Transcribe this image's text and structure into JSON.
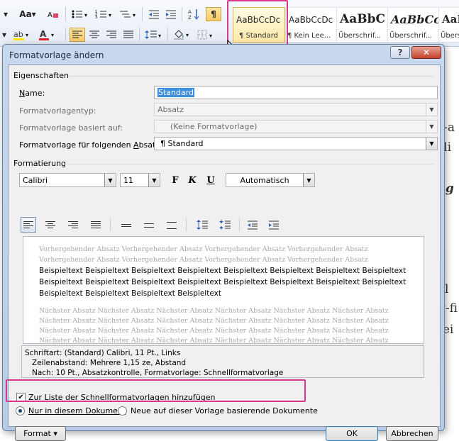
{
  "ribbon": {
    "font_size_btn": "Aa",
    "pilcrow": "¶",
    "styles": [
      {
        "sample": "AaBbCcDc",
        "caption": "¶ Standard"
      },
      {
        "sample": "AaBbCcDc",
        "caption": "¶ Kein Lee..."
      },
      {
        "sample": "AaBbC",
        "caption": "Überschrif..."
      },
      {
        "sample": "AaBbCc",
        "caption": "Überschrif..."
      },
      {
        "sample": "AaB",
        "caption": "Übers"
      }
    ]
  },
  "doc_fragments": [
    "r-a",
    "rli",
    "eg",
    "el",
    "g-fi",
    "tei"
  ],
  "dialog": {
    "title": "Formatvorlage ändern",
    "help_label": "?",
    "close_label": "✕",
    "section_properties": "Eigenschaften",
    "name_label": "Name:",
    "name_value": "Standard",
    "type_label": "Formatvorlagentyp:",
    "type_value": "Absatz",
    "based_label": "Formatvorlage basiert auf:",
    "based_value": "(Keine Formatvorlage)",
    "next_label": "Formatvorlage für folgenden Absatz:",
    "next_value": "¶  Standard",
    "section_formatting": "Formatierung",
    "font_value": "Calibri",
    "size_value": "11",
    "bold_label": "F",
    "italic_label": "K",
    "underline_label": "U",
    "color_value": "Automatisch",
    "preview": {
      "previous": "Vorhergehender Absatz Vorhergehender Absatz Vorhergehender Absatz Vorhergehender Absatz Vorhergehender Absatz Vorhergehender Absatz Vorhergehender Absatz Vorhergehender Absatz",
      "sample": "Beispieltext Beispieltext Beispieltext Beispieltext Beispieltext Beispieltext Beispieltext Beispieltext Beispieltext Beispieltext Beispieltext Beispieltext Beispieltext Beispieltext Beispieltext Beispieltext Beispieltext Beispieltext Beispieltext Beispieltext",
      "next": "Nächster Absatz Nächster Absatz Nächster Absatz Nächster Absatz Nächster Absatz Nächster Absatz Nächster Absatz Nächster Absatz Nächster Absatz Nächster Absatz Nächster Absatz Nächster Absatz Nächster Absatz Nächster Absatz Nächster Absatz Nächster Absatz Nächster Absatz Nächster Absatz Nächster Absatz Nächster Absatz Nächster Absatz Nächster Absatz Nächster Absatz Nächster Absatz Nächster Absatz Nächster Absatz Nächster Absatz Nächster Absatz"
    },
    "description": {
      "line1": "Schriftart: (Standard) Calibri, 11 Pt., Links",
      "line2": "Zeilenabstand:  Mehrere 1,15 ze, Abstand",
      "line3": "Nach:  10 Pt., Absatzkontrolle, Formatvorlage: Schnellformatvorlage"
    },
    "quick_list_label": "Zur Liste der Schnellformatvorlagen hinzufügen",
    "radio_this_doc": "Nur in diesem Dokument",
    "radio_new_docs": "Neue auf dieser Vorlage basierende Dokumente",
    "format_button": "Format ▾",
    "ok_button": "OK",
    "cancel_button": "Abbrechen"
  },
  "colors": {
    "highlight": "#d9388f",
    "accent": "#3b8ede"
  }
}
